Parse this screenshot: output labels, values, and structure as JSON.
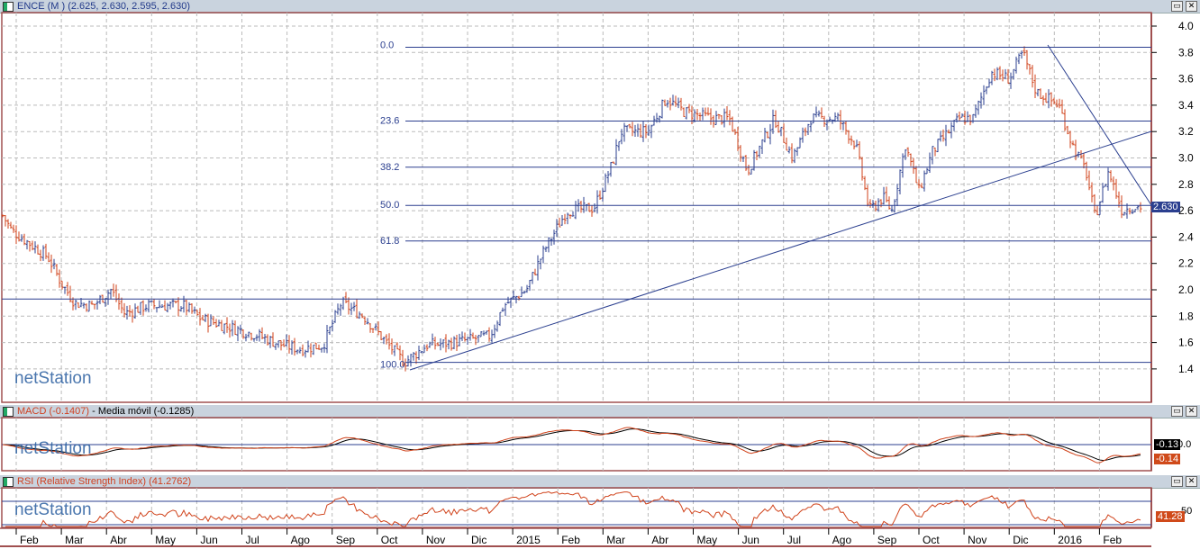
{
  "main": {
    "title": "ENCE (M ) (2.625, 2.630, 2.595, 2.630)",
    "last_price": "2.630"
  },
  "macd": {
    "title": "MACD (-0.1407)",
    "ma": "Media móvil (-0.1285)",
    "value1": "-0.13",
    "value2": "-0.14",
    "zero": "0.0"
  },
  "rsi": {
    "title": "RSI (Relative Strength Index) (41.2762)",
    "value": "41.28",
    "level": "50"
  },
  "logo": "netStation",
  "buttons": {
    "max": "▭",
    "close": "✕"
  },
  "chart_data": {
    "type": "ohlc",
    "title": "ENCE (M )",
    "ylim": [
      1.3,
      4.1
    ],
    "yticks": [
      "4.0",
      "3.8",
      "3.6",
      "3.4",
      "3.2",
      "3.0",
      "2.8",
      "2.6",
      "2.4",
      "2.2",
      "2.0",
      "1.8",
      "1.6",
      "1.4"
    ],
    "xticks": [
      "Feb",
      "Mar",
      "Abr",
      "May",
      "Jun",
      "Jul",
      "Ago",
      "Sep",
      "Oct",
      "Nov",
      "Dic",
      "2015",
      "Feb",
      "Mar",
      "Abr",
      "May",
      "Jun",
      "Jul",
      "Ago",
      "Sep",
      "Oct",
      "Nov",
      "Dic",
      "2016",
      "Feb"
    ],
    "fib_levels": [
      {
        "label": "0.0",
        "price": 3.84
      },
      {
        "label": "23.6",
        "price": 3.28
      },
      {
        "label": "38.2",
        "price": 2.93
      },
      {
        "label": "50.0",
        "price": 2.64
      },
      {
        "label": "61.8",
        "price": 2.37
      },
      {
        "label": "100.0",
        "price": 1.45
      }
    ],
    "support_line": 1.93,
    "path_month_index_price": [
      [
        -0.4,
        2.62
      ],
      [
        -0.1,
        2.45
      ],
      [
        0.3,
        2.35
      ],
      [
        0.7,
        2.25
      ],
      [
        1,
        2.05
      ],
      [
        1.3,
        1.9
      ],
      [
        1.7,
        1.88
      ],
      [
        2.1,
        2.0
      ],
      [
        2.4,
        1.82
      ],
      [
        2.9,
        1.88
      ],
      [
        3.7,
        1.88
      ],
      [
        4.1,
        1.78
      ],
      [
        4.7,
        1.72
      ],
      [
        5.3,
        1.66
      ],
      [
        5.9,
        1.58
      ],
      [
        6.3,
        1.55
      ],
      [
        6.8,
        1.58
      ],
      [
        7.2,
        1.9
      ],
      [
        7.7,
        1.8
      ],
      [
        8.2,
        1.6
      ],
      [
        8.6,
        1.45
      ],
      [
        9.1,
        1.58
      ],
      [
        9.7,
        1.6
      ],
      [
        10.5,
        1.65
      ],
      [
        10.8,
        1.88
      ],
      [
        11.3,
        2.0
      ],
      [
        11.7,
        2.3
      ],
      [
        12.2,
        2.6
      ],
      [
        12.8,
        2.62
      ],
      [
        13.2,
        2.95
      ],
      [
        13.4,
        3.2
      ],
      [
        14,
        3.2
      ],
      [
        14.4,
        3.45
      ],
      [
        14.8,
        3.35
      ],
      [
        15.4,
        3.3
      ],
      [
        15.8,
        3.3
      ],
      [
        16.2,
        2.9
      ],
      [
        16.8,
        3.3
      ],
      [
        17.2,
        3.0
      ],
      [
        17.6,
        3.3
      ],
      [
        18.2,
        3.3
      ],
      [
        18.6,
        3.1
      ],
      [
        18.9,
        2.6
      ],
      [
        19.2,
        2.7
      ],
      [
        19.4,
        2.6
      ],
      [
        19.7,
        3.1
      ],
      [
        20,
        2.75
      ],
      [
        20.3,
        3.05
      ],
      [
        20.9,
        3.3
      ],
      [
        21.2,
        3.3
      ],
      [
        21.6,
        3.65
      ],
      [
        22,
        3.6
      ],
      [
        22.3,
        3.8
      ],
      [
        22.6,
        3.5
      ],
      [
        23.1,
        3.4
      ],
      [
        23.4,
        3.1
      ],
      [
        23.7,
        2.9
      ],
      [
        23.9,
        2.55
      ],
      [
        24.2,
        2.9
      ],
      [
        24.5,
        2.6
      ],
      [
        24.7,
        2.63
      ]
    ],
    "macd_last": -0.1407,
    "macd_signal_last": -0.1285,
    "rsi_last": 41.2762
  }
}
